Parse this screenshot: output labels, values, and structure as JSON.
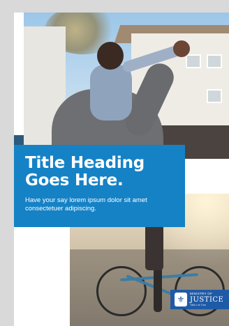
{
  "hero": {
    "title_line1": "Title Heading",
    "title_line2": "Goes Here.",
    "body": "Have your say lorem ipsum dolor sit amet consectetuer adipiscing."
  },
  "logo": {
    "line1": "MINISTRY OF",
    "line2": "JUSTICE",
    "line3": "Tāhū o te Ture",
    "crest_icon": "crest-icon"
  },
  "colors": {
    "title_box": "#1582c6",
    "accent_bar": "#2b5a7c",
    "logo_bg": "#1f5aa6"
  }
}
